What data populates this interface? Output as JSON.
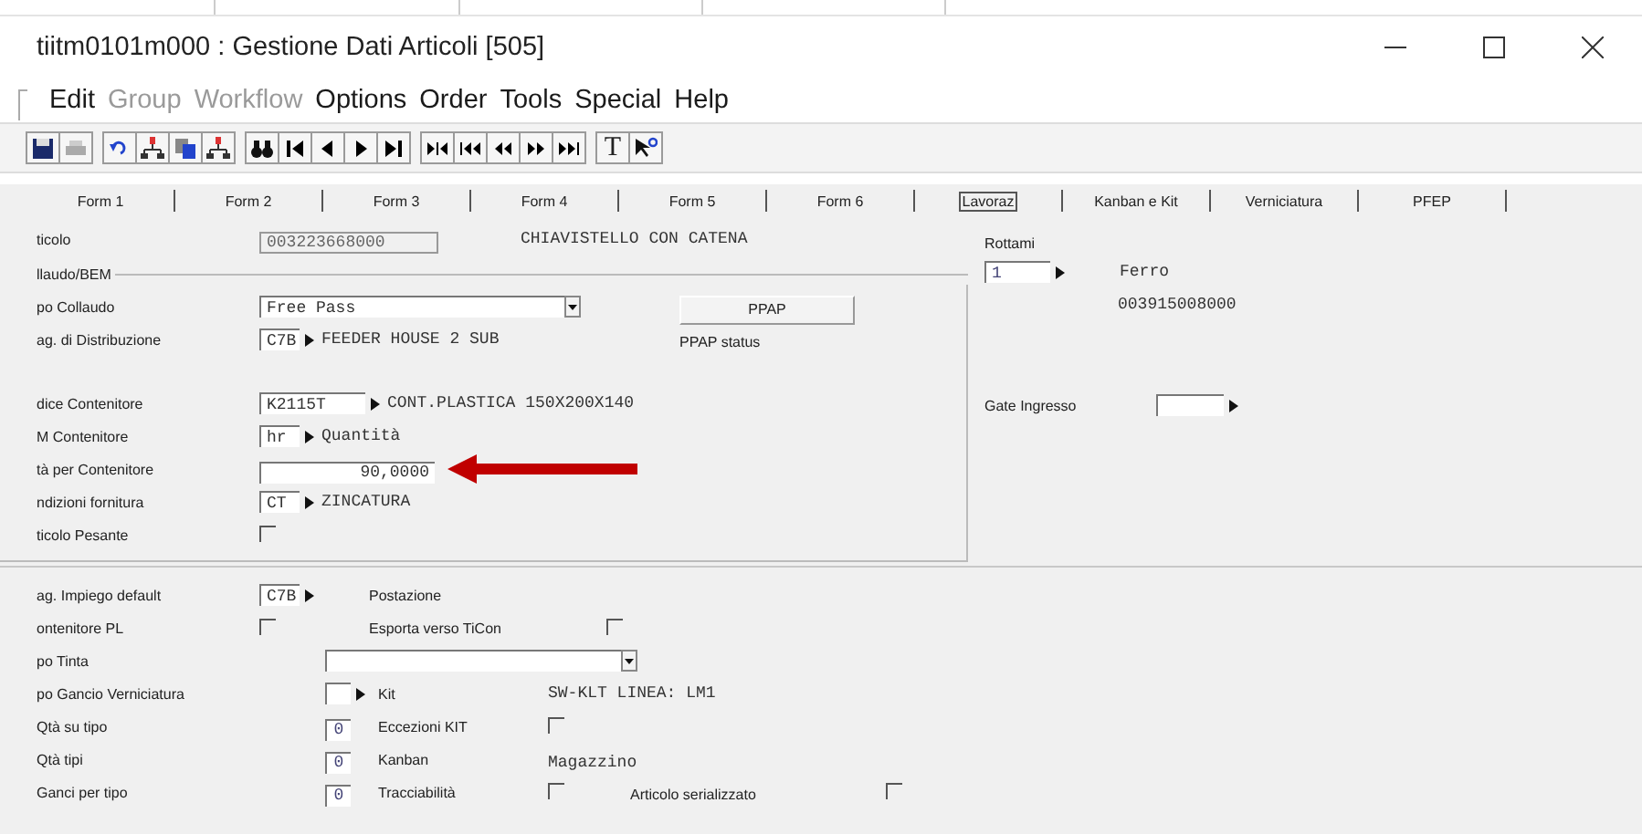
{
  "window": {
    "title": "tiitm0101m000 : Gestione Dati Articoli [505]"
  },
  "menu": [
    {
      "label": "Edit",
      "disabled": false
    },
    {
      "label": "Group",
      "disabled": true
    },
    {
      "label": "Workflow",
      "disabled": true
    },
    {
      "label": "Options",
      "disabled": false
    },
    {
      "label": "Order",
      "disabled": false
    },
    {
      "label": "Tools",
      "disabled": false
    },
    {
      "label": "Special",
      "disabled": false
    },
    {
      "label": "Help",
      "disabled": false
    }
  ],
  "toolbar": {
    "text_button": "T"
  },
  "tabs": [
    {
      "label": "Form 1",
      "selected": false
    },
    {
      "label": "Form 2",
      "selected": false
    },
    {
      "label": "Form 3",
      "selected": false
    },
    {
      "label": "Form 4",
      "selected": false
    },
    {
      "label": "Form 5",
      "selected": false
    },
    {
      "label": "Form 6",
      "selected": false
    },
    {
      "label": "Lavoraz",
      "selected": true
    },
    {
      "label": "Kanban e Kit",
      "selected": false
    },
    {
      "label": "Verniciatura",
      "selected": false
    },
    {
      "label": "PFEP",
      "selected": false
    }
  ],
  "article": {
    "label": "ticolo",
    "code": "003223668000",
    "description": "CHIAVISTELLO CON CATENA"
  },
  "group": {
    "title": "llaudo/BEM",
    "sections": [
      [
        {
          "kind": "dropdown",
          "label": "po Collaudo",
          "value": "Free Pass"
        },
        {
          "kind": "code",
          "label": "ag. di Distribuzione",
          "code": "C7B",
          "description": "FEEDER HOUSE 2 SUB"
        }
      ],
      [
        {
          "kind": "code",
          "label": "dice Contenitore",
          "code": "K2115T",
          "description": "CONT.PLASTICA 150X200X140",
          "wide": true
        },
        {
          "kind": "code",
          "label": "M Contenitore",
          "code": "hr",
          "description": "Quantità"
        },
        {
          "kind": "number",
          "label": "tà per Contenitore",
          "value": "90,0000",
          "annotation_arrow": true
        },
        {
          "kind": "code",
          "label": "ndizioni fornitura",
          "code": "CT",
          "description": "ZINCATURA"
        },
        {
          "kind": "checkbox",
          "label": "ticolo Pesante",
          "checked": false
        }
      ]
    ]
  },
  "ppap": {
    "button": "PPAP",
    "status": "PPAP status"
  },
  "rottami": {
    "label": "Rottami",
    "value": "1",
    "name": "Ferro",
    "code": "003915008000"
  },
  "gate": {
    "label": "Gate Ingresso"
  },
  "lower": [
    {
      "kind": "code_text",
      "label": "ag. Impiego default",
      "code": "C7B",
      "text": "Postazione"
    },
    {
      "kind": "check_pair",
      "label": "ontenitore PL",
      "checked": false,
      "text": "Esporta verso TiCon",
      "checked2": false
    },
    {
      "kind": "dropdown",
      "label": "po Tinta"
    },
    {
      "kind": "lookup",
      "label": "po Gancio Verniciatura",
      "text": "Kit",
      "note": "SW-KLT LINEA: LM1"
    },
    {
      "kind": "count",
      "label": "Qtà su tipo",
      "value": "0",
      "text": "Eccezioni KIT",
      "checked": false
    },
    {
      "kind": "count",
      "label": "Qtà tipi",
      "value": "0",
      "text": "Kanban",
      "note": "Magazzino"
    },
    {
      "kind": "count",
      "label": "Ganci per tipo",
      "value": "0",
      "text": "Tracciabilità",
      "checked": false,
      "text2": "Articolo serializzato",
      "checked2": false
    }
  ]
}
